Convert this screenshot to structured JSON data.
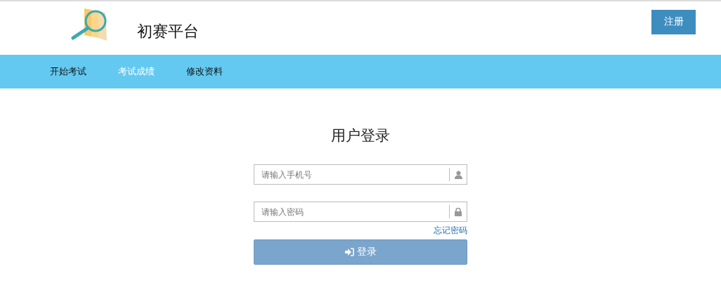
{
  "header": {
    "title": "初赛平台",
    "register_button": "注册"
  },
  "nav": [
    {
      "label": "开始考试",
      "selected": false
    },
    {
      "label": "考试成绩",
      "selected": true
    },
    {
      "label": "修改资料",
      "selected": false
    }
  ],
  "login": {
    "title": "用户登录",
    "fields": [
      {
        "placeholder": "请输入手机号",
        "kind": "user"
      },
      {
        "placeholder": "请输入密码",
        "kind": "password"
      }
    ],
    "forgot_link": "忘记密码",
    "submit": "登录"
  }
}
